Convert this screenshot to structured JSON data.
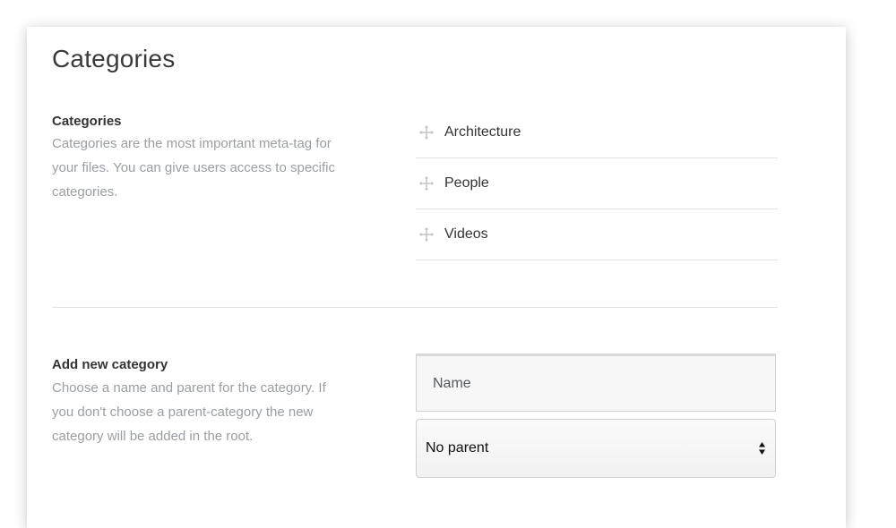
{
  "page": {
    "title": "Categories"
  },
  "categories_section": {
    "heading": "Categories",
    "description": "Categories are the most important meta-tag for your files. You can give users access to specific categories.",
    "items": [
      {
        "label": "Architecture",
        "icon": "drag-move-icon"
      },
      {
        "label": "People",
        "icon": "drag-move-icon"
      },
      {
        "label": "Videos",
        "icon": "drag-move-icon"
      }
    ]
  },
  "add_section": {
    "heading": "Add new category",
    "description": "Choose a name and parent for the category. If you don't choose a parent-category the new category will be added in the root.",
    "name_field": {
      "value": "",
      "placeholder": "Name"
    },
    "parent_select": {
      "selected": "No parent",
      "icon": "select-arrows-icon"
    }
  },
  "colors": {
    "heading_text": "#333333",
    "muted_text": "#9a9ea3",
    "divider": "#e3e3e3"
  }
}
